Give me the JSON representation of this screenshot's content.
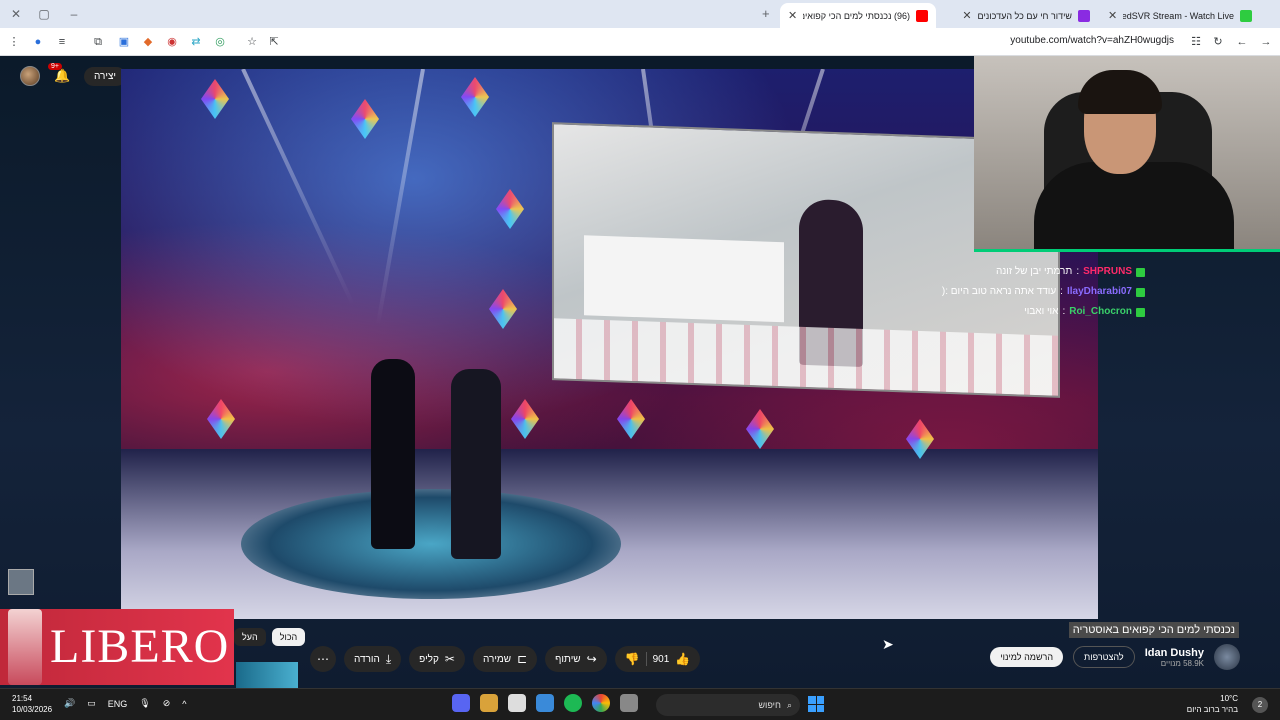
{
  "window": {
    "controls": [
      "✕",
      "▢",
      "–"
    ]
  },
  "tabs": [
    {
      "title": "OdedSVR Stream - Watch Live",
      "favicon_color": "#2ecc40",
      "favicon": "kick-icon"
    },
    {
      "title": "שידור חי עם כל העדכונים",
      "favicon_color": "#8a2be2",
      "favicon": "twitch-icon"
    },
    {
      "title": "(96) נכנסתי למים הכי קפואים באוסטר...",
      "favicon_color": "#ff0000",
      "favicon": "youtube-icon"
    }
  ],
  "address": {
    "url": "youtube.com/watch?v=ahZH0wugdjs"
  },
  "youtube": {
    "create_label": "יצירה",
    "notification_count": "9+",
    "video_title": "נכנסתי למים הכי קפואים באוסטריה",
    "channel": {
      "name": "Idan Dushy",
      "subs": "58.9K מנויים"
    },
    "join_label": "להצטרפות",
    "subscribe_label": "הרשמה למינוי",
    "actions": {
      "likes": "901",
      "share": "שיתוף",
      "save": "שמירה",
      "clip": "קליפ",
      "download": "הורדה"
    },
    "chips": [
      "הכול",
      "העל"
    ]
  },
  "chat": [
    {
      "user": "SHPRUNS",
      "message": "תרמתי יבן של זונה",
      "color": "#ff2a6a"
    },
    {
      "user": "IlayDharabi07",
      "message": "עודד אתה נראה טוב היום :(",
      "color": "#8a6cff"
    },
    {
      "user": "Roi_Chocron",
      "message": "אוי ואבוי",
      "color": "#3ad16a"
    }
  ],
  "ad": {
    "brand": "LIBERO"
  },
  "taskbar": {
    "time": "21:54",
    "date": "10/03/2026",
    "lang": "ENG",
    "search_placeholder": "חיפוש",
    "weather_temp": "10°C",
    "weather_desc": "בהיר ברוב היום",
    "notif_count": "2"
  }
}
